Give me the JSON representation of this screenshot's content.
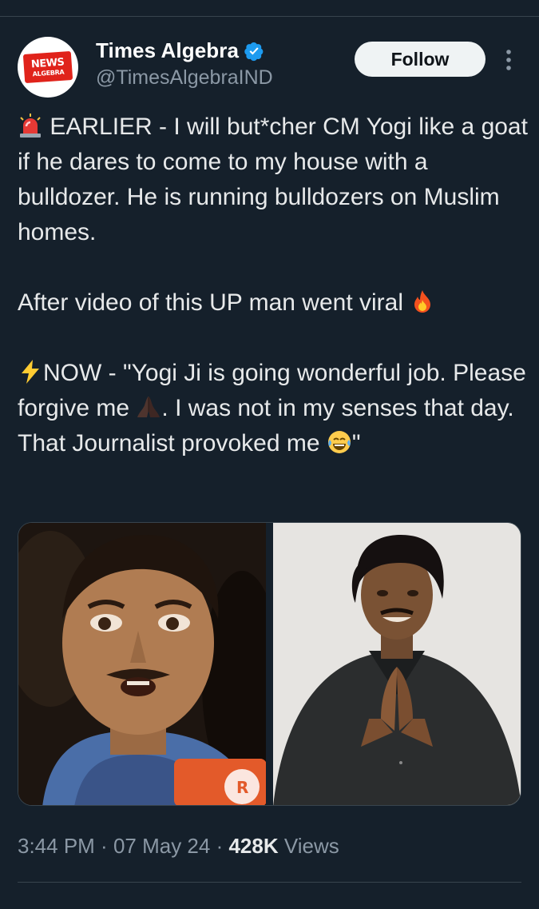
{
  "account": {
    "avatar_line1": "NEWS",
    "avatar_line2": "ALGEBRA",
    "display_name": "Times Algebra",
    "handle": "@TimesAlgebraIND",
    "verified": true
  },
  "actions": {
    "follow_label": "Follow"
  },
  "tweet": {
    "line1": "EARLIER - I will but*cher CM Yogi like a goat if he dares to come to my house with a bulldozer. He is running bulldozers on Muslim homes.",
    "line2": "After video of this UP man went viral",
    "line3a": "NOW - \"Yogi Ji is going wonderful job. Please forgive me",
    "line3b": ". I was not in my senses that day. That Journalist provoked me",
    "line3c": "\""
  },
  "meta": {
    "time": "3:44 PM",
    "sep1": " · ",
    "date": "07 May 24",
    "sep2": " · ",
    "views_count": "428K",
    "views_label": " Views"
  },
  "colors": {
    "background": "#15202b",
    "verified": "#1d9bf0",
    "divider": "#38444d",
    "secondary_text": "#8b98a5"
  },
  "icons": [
    "siren-emoji",
    "fire-emoji",
    "lightning-emoji",
    "folded-hands-emoji",
    "laughing-emoji",
    "verified-badge-icon",
    "more-options-icon"
  ]
}
